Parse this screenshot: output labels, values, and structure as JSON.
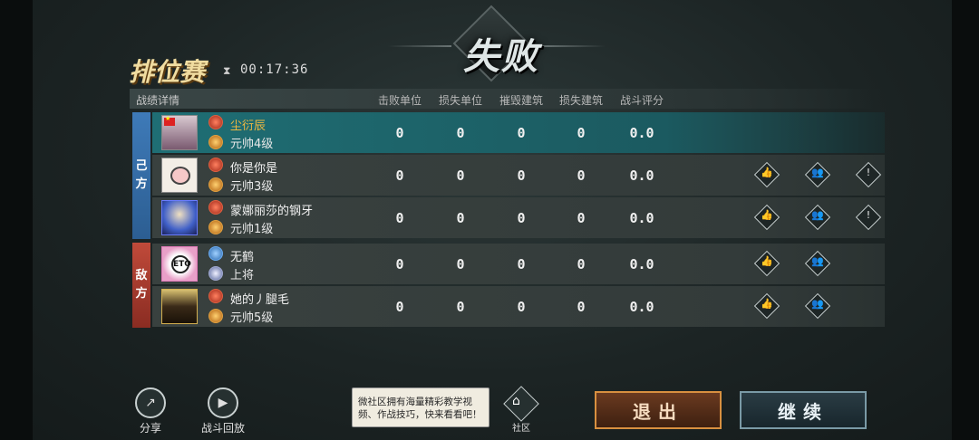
{
  "result_title": "失败",
  "mode_title": "排位赛",
  "timer": "00:17:36",
  "table": {
    "header_label": "战绩详情",
    "columns": [
      "击败单位",
      "损失单位",
      "摧毁建筑",
      "损失建筑",
      "战斗评分"
    ]
  },
  "sides": {
    "ally": [
      "己",
      "方"
    ],
    "enemy": [
      "敌",
      "方"
    ]
  },
  "players": [
    {
      "name": "尘衍辰",
      "rank": "元帅4级",
      "stats": [
        "0",
        "0",
        "0",
        "0",
        "0.0"
      ],
      "highlight": true,
      "actions": []
    },
    {
      "name": "你是你是",
      "rank": "元帅3级",
      "stats": [
        "0",
        "0",
        "0",
        "0",
        "0.0"
      ],
      "highlight": false,
      "actions": [
        "like",
        "add-friend",
        "report"
      ]
    },
    {
      "name": "蒙娜丽莎的钢牙",
      "rank": "元帅1级",
      "stats": [
        "0",
        "0",
        "0",
        "0",
        "0.0"
      ],
      "highlight": false,
      "actions": [
        "like",
        "add-friend",
        "report"
      ]
    },
    {
      "name": "无鹤",
      "rank": "上将",
      "stats": [
        "0",
        "0",
        "0",
        "0",
        "0.0"
      ],
      "highlight": false,
      "actions": [
        "like",
        "add-friend"
      ]
    },
    {
      "name": "她的丿腿毛",
      "rank": "元帅5级",
      "stats": [
        "0",
        "0",
        "0",
        "0",
        "0.0"
      ],
      "highlight": false,
      "actions": [
        "like",
        "add-friend"
      ]
    }
  ],
  "avatar_logo_text": "ETO",
  "bottom": {
    "share_label": "分享",
    "replay_label": "战斗回放",
    "notice_text": "微社区拥有海量精彩教学视频、作战技巧，快来看看吧！",
    "community_label": "社区",
    "exit_label": "退出",
    "continue_label": "继续"
  },
  "colors": {
    "highlight_row": "#1f6e74",
    "ally_side": "#3e7ab8",
    "enemy_side": "#c04a3a",
    "exit_border": "#d89040",
    "name_gold": "#f0b840"
  }
}
